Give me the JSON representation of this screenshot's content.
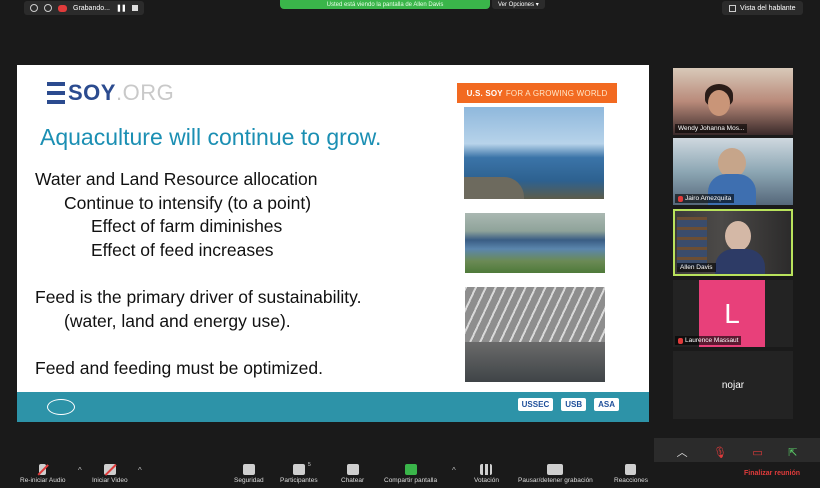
{
  "topbar": {
    "recording_label": "Grabando...",
    "share_banner": "Usted está viendo la pantalla de Allen Davis",
    "view_options": "Ver Opciones",
    "speaker_view": "Vista del hablante"
  },
  "slide": {
    "logo_us": "US",
    "logo_soy": "SOY",
    "logo_org": ".ORG",
    "badge_main": "U.S. SOY",
    "badge_light": "FOR A GROWING WORLD",
    "title": "Aquaculture will continue to grow.",
    "bullets": [
      "Water and Land Resource allocation",
      "Continue to intensify (to a point)",
      "Effect of farm diminishes",
      "Effect of feed increases",
      "Feed is the primary driver of sustainability.",
      "(water, land and energy use).",
      "Feed and feeding must be optimized."
    ],
    "footer_logos": [
      "USSEC",
      "USB",
      "ASA"
    ]
  },
  "participants": [
    {
      "name": "Wendy Johanna Mos..."
    },
    {
      "name": "Jairo Amezquita"
    },
    {
      "name": "Allen Davis"
    },
    {
      "name": "Laurence Massaut",
      "avatar_letter": "L"
    },
    {
      "name": "nojar"
    }
  ],
  "toolbar": {
    "audio": "Re-iniciar Audio",
    "video": "Iniciar Video",
    "security": "Seguridad",
    "participants": "Participantes",
    "participants_count": "5",
    "chat": "Chatear",
    "share": "Compartir pantalla",
    "poll": "Votación",
    "record": "Pausar/detener grabación",
    "reactions": "Reacciones",
    "end": "Finalizar reunión"
  },
  "colors": {
    "accent_green": "#3ab54a",
    "active_border": "#b9e25c",
    "slide_title": "#1b8fb3",
    "footer_bar": "#2d93a8",
    "badge": "#f26a21",
    "end_red": "#e03b3b"
  }
}
